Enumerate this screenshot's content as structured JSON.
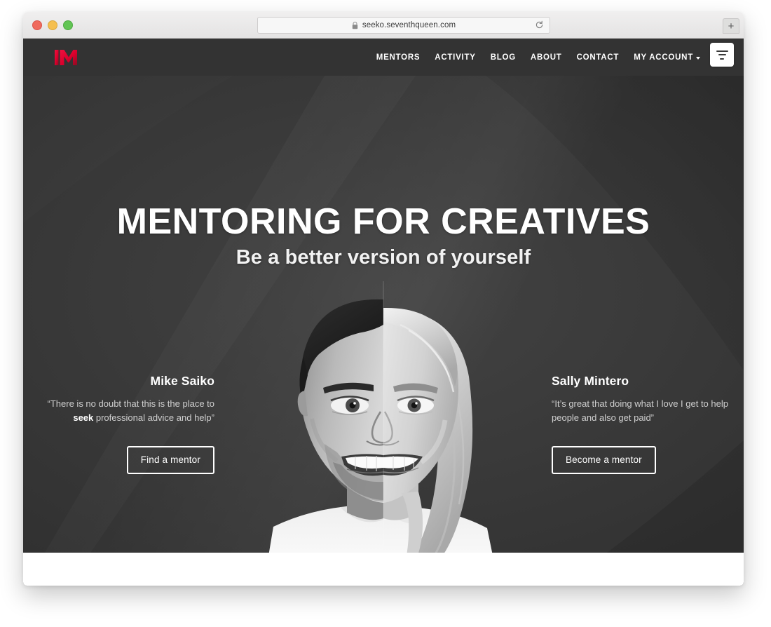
{
  "browser": {
    "url": "seeko.seventhqueen.com",
    "lock_icon": "lock-icon",
    "reload_icon": "reload-icon",
    "newtab_label": "+",
    "traffic_lights": [
      "close",
      "minimize",
      "maximize"
    ]
  },
  "site": {
    "logo_letter": "M",
    "logo_color": "#e4002e",
    "header_bg": "#333333",
    "nav": [
      {
        "label": "MENTORS"
      },
      {
        "label": "ACTIVITY"
      },
      {
        "label": "BLOG"
      },
      {
        "label": "ABOUT"
      },
      {
        "label": "CONTACT"
      },
      {
        "label": "MY ACCOUNT",
        "has_chevron": true
      }
    ],
    "menu_button": "filter-menu-icon"
  },
  "hero": {
    "title": "MENTORING FOR CREATIVES",
    "subtitle": "Be a better version of yourself",
    "background_color": "#3a3a3a",
    "image": "split-face-portrait-man-woman",
    "testimonials": [
      {
        "name": "Mike Saiko",
        "quote_before": "“There is no doubt that this is the place to ",
        "quote_bold": "seek",
        "quote_after": " professional advice and help”",
        "button": "Find a mentor"
      },
      {
        "name": "Sally Mintero",
        "quote_before": "“It’s great that doing what I love I get to help people and also get paid”",
        "quote_bold": "",
        "quote_after": "",
        "button": "Become a mentor"
      }
    ]
  }
}
